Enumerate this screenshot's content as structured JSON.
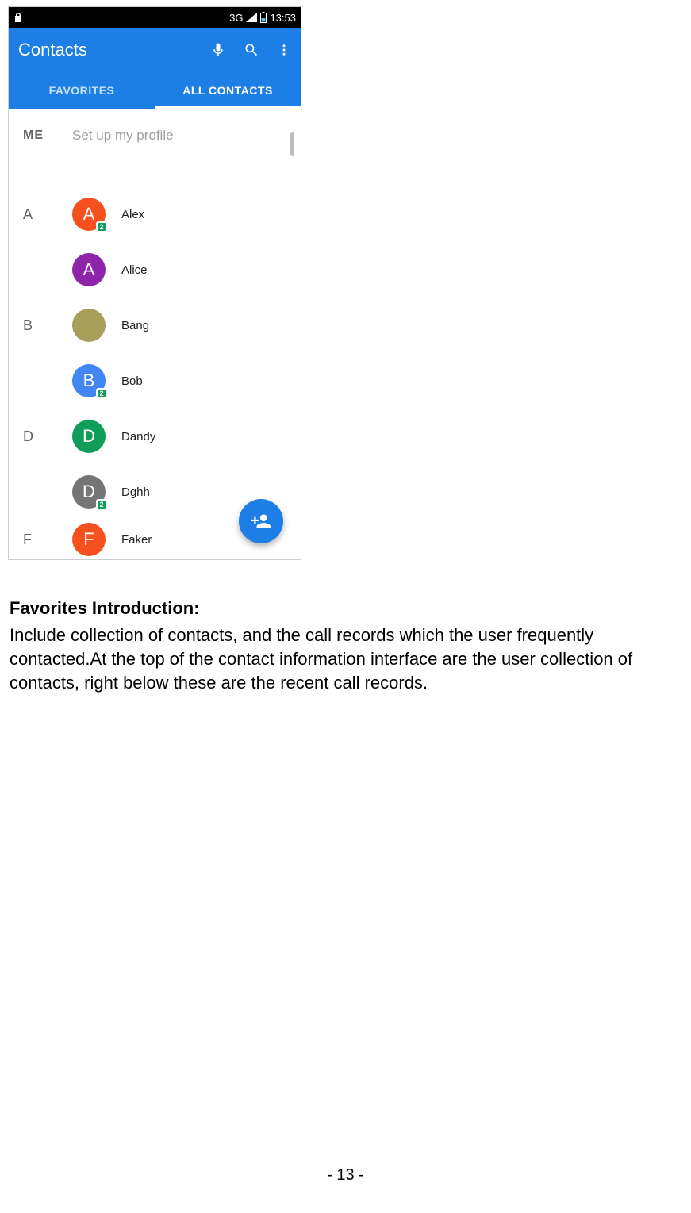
{
  "status_bar": {
    "network": "3G",
    "time": "13:53"
  },
  "app_bar": {
    "title": "Contacts"
  },
  "tabs": {
    "favorites": "FAVORITES",
    "all": "ALL CONTACTS"
  },
  "me": {
    "label": "ME",
    "text": "Set up my profile"
  },
  "sections": [
    {
      "letter": "A",
      "contacts": [
        {
          "initial": "A",
          "name": "Alex",
          "color": "#f4511e",
          "badge": "2"
        },
        {
          "initial": "A",
          "name": "Alice",
          "color": "#8e24aa",
          "badge": ""
        }
      ]
    },
    {
      "letter": "B",
      "contacts": [
        {
          "initial": "",
          "name": "Bang",
          "color": "#a7a05a",
          "badge": "",
          "image": true
        },
        {
          "initial": "B",
          "name": "Bob",
          "color": "#4285f4",
          "badge": "2"
        }
      ]
    },
    {
      "letter": "D",
      "contacts": [
        {
          "initial": "D",
          "name": "Dandy",
          "color": "#0f9d58",
          "badge": ""
        },
        {
          "initial": "D",
          "name": "Dghh",
          "color": "#757575",
          "badge": "2"
        }
      ]
    },
    {
      "letter": "F",
      "contacts": [
        {
          "initial": "F",
          "name": "Faker",
          "color": "#f4511e",
          "badge": ""
        }
      ]
    }
  ],
  "document": {
    "heading": "Favorites Introduction:",
    "body": "Include collection of contacts, and the call records which the user frequently contacted.At the top of the contact information interface are the user collection of contacts, right below these are the recent call records."
  },
  "footer": {
    "page_number": "- 13 -"
  }
}
